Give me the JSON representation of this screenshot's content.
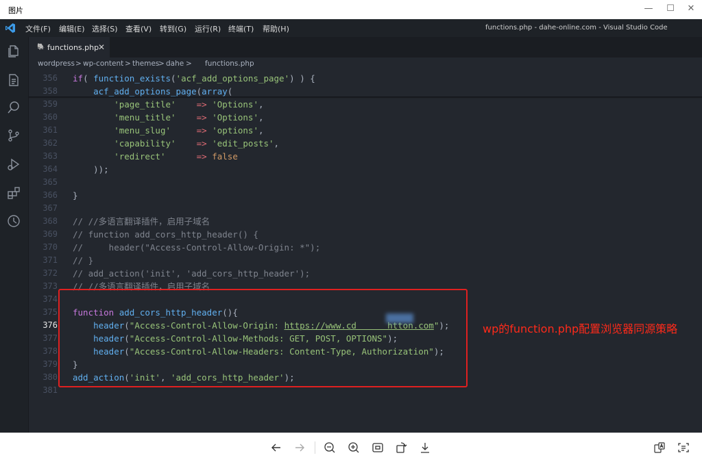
{
  "viewer": {
    "title": "图片",
    "controls": {
      "minimize": "—",
      "maximize": "☐",
      "close": "✕"
    }
  },
  "menubar": {
    "items": [
      "文件(F)",
      "编辑(E)",
      "选择(S)",
      "查看(V)",
      "转到(G)",
      "运行(R)",
      "终端(T)",
      "帮助(H)"
    ],
    "window_title": "functions.php - dahe-online.com - Visual Studio Code"
  },
  "tab": {
    "icon": "php-elephant-icon",
    "label": "functions.php",
    "close": "✕"
  },
  "breadcrumb": [
    "wordpress",
    ">",
    "wp-content",
    ">",
    "themes",
    ">",
    "dahe",
    ">",
    "functions.php"
  ],
  "editor": {
    "lines": [
      {
        "num": "356",
        "text": "if( function_exists('acf_add_options_page') ) {"
      },
      {
        "num": "358",
        "text": "    acf_add_options_page(array("
      },
      {
        "num": "359",
        "text": "        'page_title'    => 'Options',"
      },
      {
        "num": "360",
        "text": "        'menu_title'    => 'Options',"
      },
      {
        "num": "361",
        "text": "        'menu_slug'     => 'options',"
      },
      {
        "num": "362",
        "text": "        'capability'    => 'edit_posts',"
      },
      {
        "num": "363",
        "text": "        'redirect'      => false"
      },
      {
        "num": "364",
        "text": "    ));"
      },
      {
        "num": "365",
        "text": ""
      },
      {
        "num": "366",
        "text": "}"
      },
      {
        "num": "367",
        "text": ""
      },
      {
        "num": "368",
        "text": "// //多语言翻译插件，启用子域名"
      },
      {
        "num": "369",
        "text": "// function add_cors_http_header() {"
      },
      {
        "num": "370",
        "text": "//     header(\"Access-Control-Allow-Origin: *\");"
      },
      {
        "num": "371",
        "text": "// }"
      },
      {
        "num": "372",
        "text": "// add_action('init', 'add_cors_http_header');"
      },
      {
        "num": "373",
        "text": "// //多语言翻译插件，启用子域名"
      },
      {
        "num": "374",
        "text": ""
      },
      {
        "num": "375",
        "text": "function add_cors_http_header(){"
      },
      {
        "num": "376",
        "text": "    header(\"Access-Control-Allow-Origin: https://www.cd      htton.com\");"
      },
      {
        "num": "377",
        "text": "    header(\"Access-Control-Allow-Methods: GET, POST, OPTIONS\");"
      },
      {
        "num": "378",
        "text": "    header(\"Access-Control-Allow-Headers: Content-Type, Authorization\");"
      },
      {
        "num": "379",
        "text": "}"
      },
      {
        "num": "380",
        "text": "add_action('init', 'add_cors_http_header');"
      },
      {
        "num": "381",
        "text": ""
      }
    ],
    "active_line": "376"
  },
  "annotation": "wp的function.php配置浏览器同源策略",
  "colors": {
    "accent_red": "#e02020",
    "annotation": "#ff2a1a",
    "editor_bg": "#23272e"
  }
}
